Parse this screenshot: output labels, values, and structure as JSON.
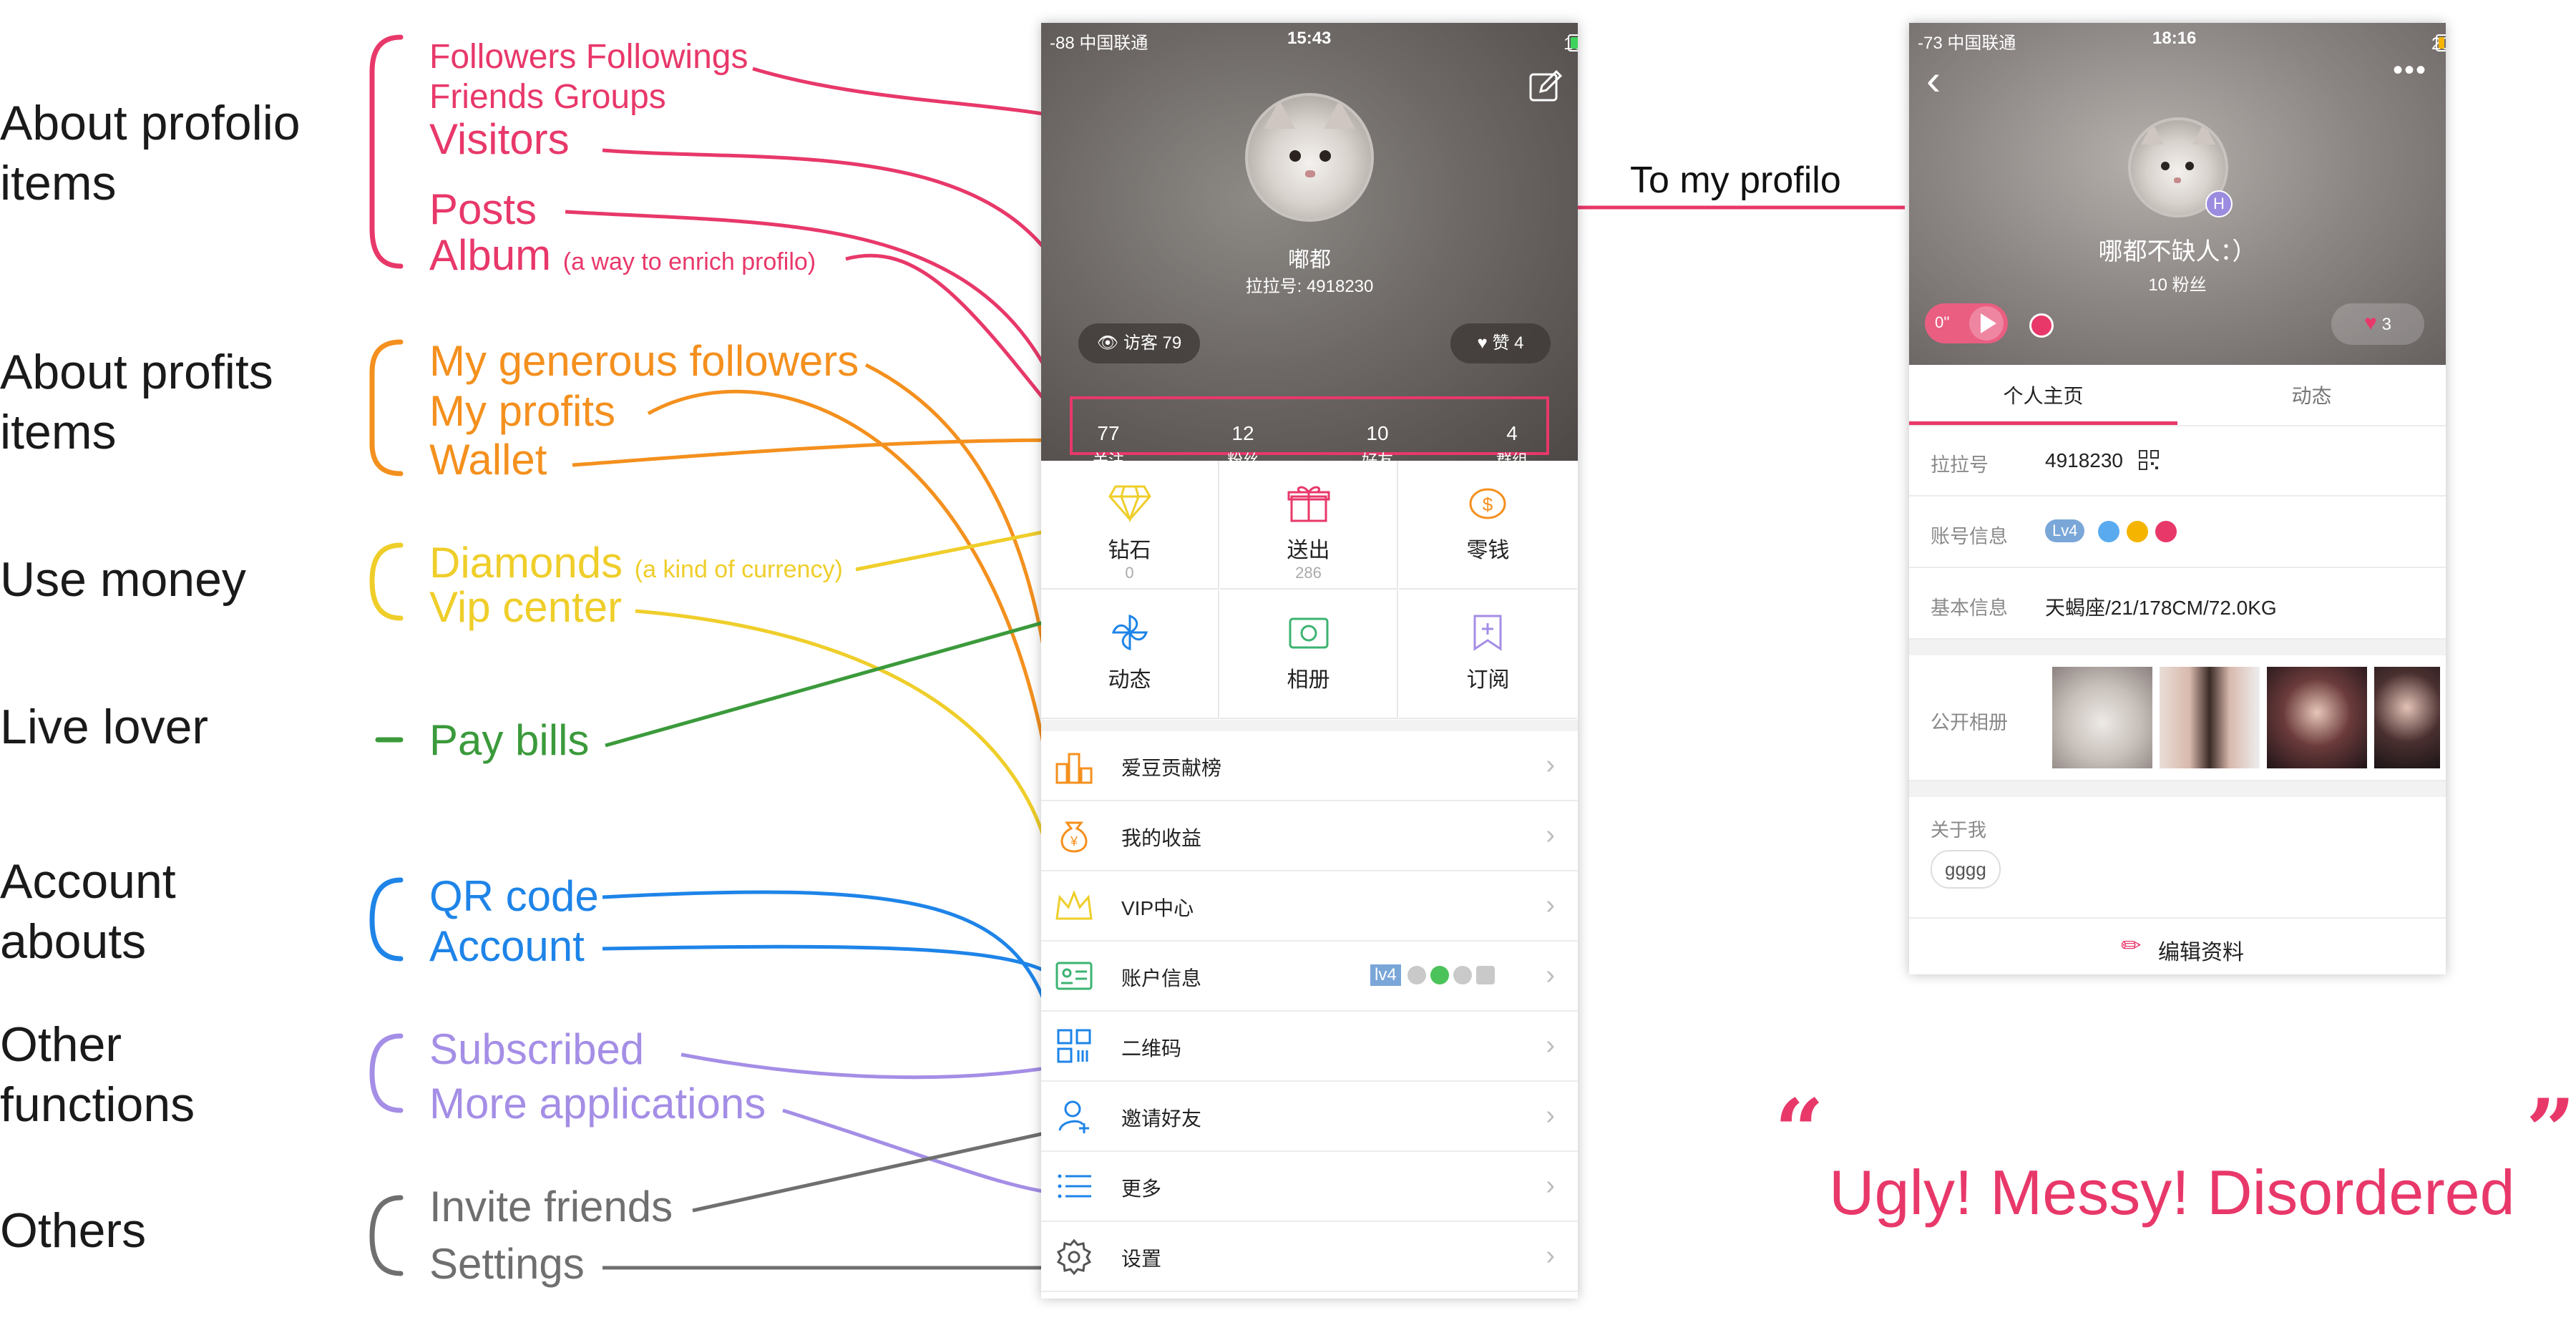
{
  "categories": [
    {
      "key": "profolio",
      "label": "About profolio\nitems"
    },
    {
      "key": "profits",
      "label": "About profits\nitems"
    },
    {
      "key": "money",
      "label": "Use money"
    },
    {
      "key": "live",
      "label": "Live lover"
    },
    {
      "key": "account",
      "label": "Account\nabouts"
    },
    {
      "key": "other",
      "label": "Other\nfunctions"
    },
    {
      "key": "others",
      "label": "Others"
    }
  ],
  "annotations": {
    "followers_line1": "Followers Followings",
    "followers_line2": "Friends Groups",
    "visitors": "Visitors",
    "posts": "Posts",
    "album": "Album",
    "album_note": "(a way to enrich profilo)",
    "generous": "My generous followers",
    "profits": "My profits",
    "wallet": "Wallet",
    "diamonds": "Diamonds",
    "diamonds_note": "(a kind of currency)",
    "vip": "Vip center",
    "pay_bills": "Pay bills",
    "qr": "QR code",
    "account": "Account",
    "subscribed": "Subscribed",
    "more_apps": "More applications",
    "invite": "Invite friends",
    "settings": "Settings",
    "to_profile": "To my profilo",
    "verdict": "Ugly! Messy! Disordered"
  },
  "colors": {
    "pink": "#e8386a",
    "orange": "#f4901e",
    "yellow": "#efce2a",
    "green": "#3b9a3b",
    "blue": "#1e84e8",
    "purple": "#a48ee6",
    "gray": "#6f6f6f"
  },
  "phone1": {
    "status": {
      "carrier": "-88 中国联通",
      "time": "15:43",
      "battery": "100%"
    },
    "battery_level": 1.0,
    "name": "嘟都",
    "id_line": "拉拉号: 4918230",
    "visitors_pill": "访客 79",
    "likes_pill": "赞 4",
    "stats": [
      {
        "num": "77",
        "label": "关注"
      },
      {
        "num": "12",
        "label": "粉丝"
      },
      {
        "num": "10",
        "label": "好友"
      },
      {
        "num": "4",
        "label": "群组"
      }
    ],
    "grid": [
      {
        "label": "钻石",
        "sub": "0"
      },
      {
        "label": "送出",
        "sub": "286"
      },
      {
        "label": "零钱",
        "sub": ""
      },
      {
        "label": "动态",
        "sub": ""
      },
      {
        "label": "相册",
        "sub": ""
      },
      {
        "label": "订阅",
        "sub": ""
      }
    ],
    "list": [
      {
        "label": "爱豆贡献榜"
      },
      {
        "label": "我的收益"
      },
      {
        "label": "VIP中心"
      },
      {
        "label": "账户信息",
        "badge": "lv4"
      },
      {
        "label": "二维码"
      },
      {
        "label": "邀请好友"
      },
      {
        "label": "更多"
      },
      {
        "label": "设置"
      }
    ]
  },
  "phone2": {
    "status": {
      "carrier": "-73 中国联通",
      "time": "18:16",
      "battery": "20%"
    },
    "battery_level": 0.2,
    "name": "哪都不缺人：）",
    "fans": "10 粉丝",
    "badge_letter": "H",
    "audio_len": "0''",
    "likes": "3",
    "tabs": [
      "个人主页",
      "动态"
    ],
    "rows": [
      {
        "key": "拉拉号",
        "value": "4918230"
      },
      {
        "key": "账号信息",
        "value": "Lv4"
      },
      {
        "key": "基本信息",
        "value": "天蝎座/21/178CM/72.0KG"
      },
      {
        "key": "公开相册",
        "value": ""
      }
    ],
    "about_label": "关于我",
    "about_tag": "gggg",
    "edit_label": "编辑资料"
  }
}
